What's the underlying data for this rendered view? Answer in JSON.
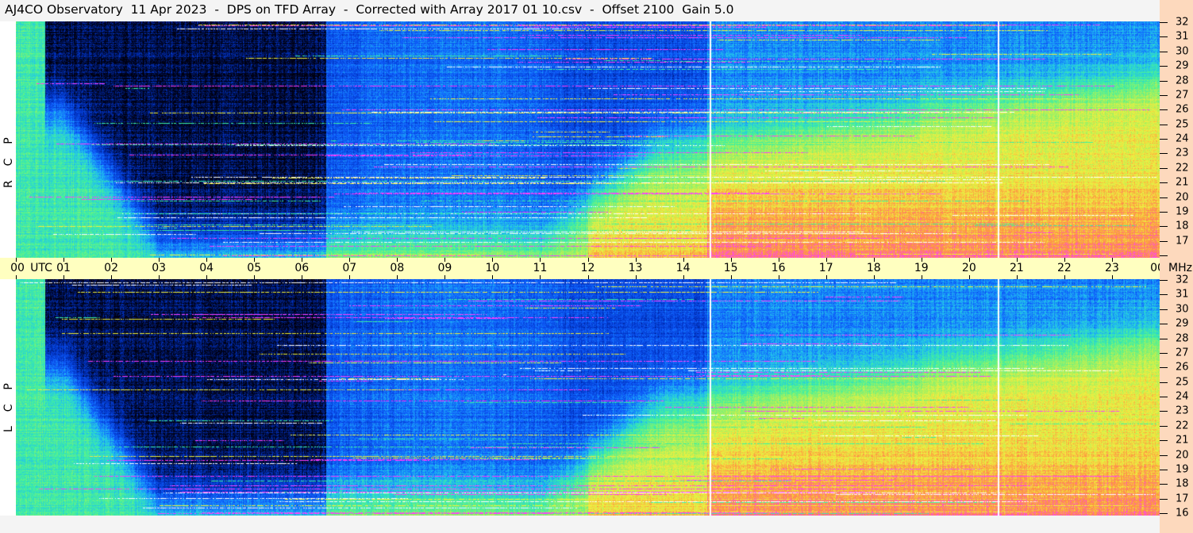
{
  "title": "AJ4CO Observatory  11 Apr 2023  -  DPS on TFD Array  -  Corrected with Array 2017 01 10.csv  -  Offset 2100  Gain 5.0",
  "chart_data": {
    "type": "heatmap",
    "title": "AJ4CO Observatory  11 Apr 2023  -  DPS on TFD Array  -  Corrected with Array 2017 01 10.csv  -  Offset 2100  Gain 5.0",
    "xlabel": "UTC",
    "ylabel": "MHz",
    "xlim": [
      0,
      24
    ],
    "ylim": [
      16,
      32
    ],
    "x_ticks": [
      "00",
      "01",
      "02",
      "03",
      "04",
      "05",
      "06",
      "07",
      "08",
      "09",
      "10",
      "11",
      "12",
      "13",
      "14",
      "15",
      "16",
      "17",
      "18",
      "19",
      "20",
      "21",
      "22",
      "23",
      "00"
    ],
    "y_ticks": [
      "16",
      "17",
      "18",
      "19",
      "20",
      "21",
      "22",
      "23",
      "24",
      "25",
      "26",
      "27",
      "28",
      "29",
      "30",
      "31",
      "32"
    ],
    "utc_label": "UTC",
    "mhz_label": "MHz",
    "panels": [
      {
        "name": "RCP",
        "label": "R  C  P"
      },
      {
        "name": "LCP",
        "label": "L  C  P"
      }
    ],
    "offset": 2100,
    "gain": 5.0,
    "colormap": [
      "#000010",
      "#0030c0",
      "#1060ff",
      "#20c0f0",
      "#40f0a0",
      "#a0f060",
      "#f0f040",
      "#ff9040",
      "#ff40ff"
    ],
    "vertical_markers_utc": [
      14.55,
      20.6
    ]
  }
}
